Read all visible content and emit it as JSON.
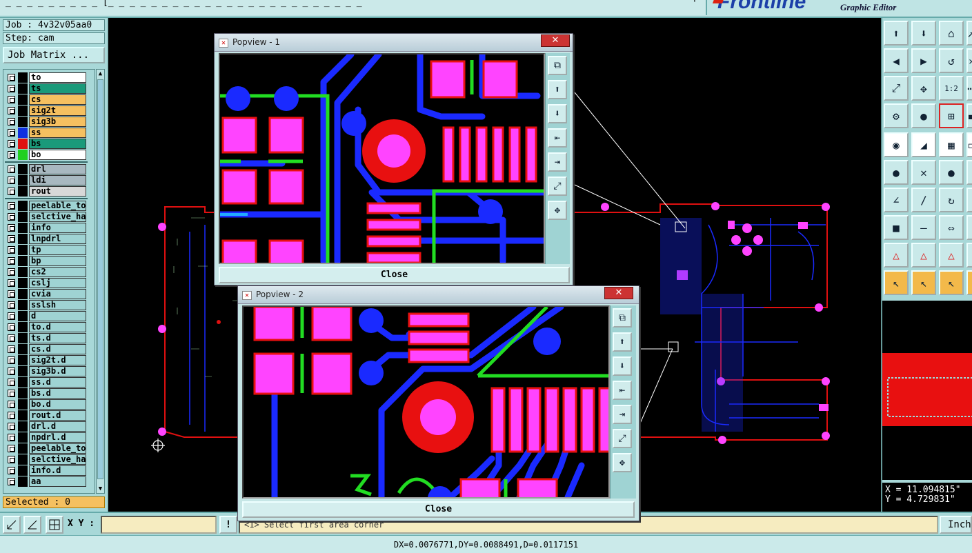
{
  "topbar": {
    "menu_text": "_ _ _ _ _ _ _ _ _ [_ _ _ _ _ _ _ _ _ _ _ _ _ _ _ _ _ _ _ _ _ _ _ _",
    "right_char": "'"
  },
  "brand": {
    "logo": "Frontline",
    "subtitle": "Graphic Editor"
  },
  "job": {
    "job_label": "Job : 4v32v05aa0",
    "step_label": "Step: cam",
    "matrix_button": "Job Matrix ..."
  },
  "layers": [
    {
      "name": "to",
      "swatch": "#000000",
      "bg": "#ffffff"
    },
    {
      "name": "ts",
      "swatch": "#000000",
      "bg": "#1a9a7a"
    },
    {
      "name": "cs",
      "swatch": "#000000",
      "bg": "#f5c060"
    },
    {
      "name": "sig2t",
      "swatch": "#000000",
      "bg": "#f5c060"
    },
    {
      "name": "sig3b",
      "swatch": "#000000",
      "bg": "#f5c060"
    },
    {
      "name": "ss",
      "swatch": "#1030e0",
      "bg": "#f5c060"
    },
    {
      "name": "bs",
      "swatch": "#e01010",
      "bg": "#1a9a7a"
    },
    {
      "name": "bo",
      "swatch": "#20d020",
      "bg": "#ffffff"
    },
    {
      "name": "drl",
      "swatch": "#000000",
      "bg": "#a8b8c0"
    },
    {
      "name": "ldi",
      "swatch": "#000000",
      "bg": "#a8b8c0"
    },
    {
      "name": "rout",
      "swatch": "#000000",
      "bg": "#d8d8d8"
    },
    {
      "name": "peelable_top",
      "swatch": "#000000",
      "bg": "#9fd3d3"
    },
    {
      "name": "selctive_hard",
      "swatch": "#000000",
      "bg": "#9fd3d3"
    },
    {
      "name": "info",
      "swatch": "#000000",
      "bg": "#9fd3d3"
    },
    {
      "name": "lnpdrl",
      "swatch": "#000000",
      "bg": "#9fd3d3"
    },
    {
      "name": "tp",
      "swatch": "#000000",
      "bg": "#9fd3d3"
    },
    {
      "name": "bp",
      "swatch": "#000000",
      "bg": "#9fd3d3"
    },
    {
      "name": "cs2",
      "swatch": "#000000",
      "bg": "#9fd3d3"
    },
    {
      "name": "cslj",
      "swatch": "#000000",
      "bg": "#9fd3d3"
    },
    {
      "name": "cvia",
      "swatch": "#000000",
      "bg": "#9fd3d3"
    },
    {
      "name": "sslsh",
      "swatch": "#000000",
      "bg": "#9fd3d3"
    },
    {
      "name": "d",
      "swatch": "#000000",
      "bg": "#9fd3d3"
    },
    {
      "name": "to.d",
      "swatch": "#000000",
      "bg": "#9fd3d3"
    },
    {
      "name": "ts.d",
      "swatch": "#000000",
      "bg": "#9fd3d3"
    },
    {
      "name": "cs.d",
      "swatch": "#000000",
      "bg": "#9fd3d3"
    },
    {
      "name": "sig2t.d",
      "swatch": "#000000",
      "bg": "#9fd3d3"
    },
    {
      "name": "sig3b.d",
      "swatch": "#000000",
      "bg": "#9fd3d3"
    },
    {
      "name": "ss.d",
      "swatch": "#000000",
      "bg": "#9fd3d3"
    },
    {
      "name": "bs.d",
      "swatch": "#000000",
      "bg": "#9fd3d3"
    },
    {
      "name": "bo.d",
      "swatch": "#000000",
      "bg": "#9fd3d3"
    },
    {
      "name": "rout.d",
      "swatch": "#000000",
      "bg": "#9fd3d3"
    },
    {
      "name": "drl.d",
      "swatch": "#000000",
      "bg": "#9fd3d3"
    },
    {
      "name": "npdrl.d",
      "swatch": "#000000",
      "bg": "#9fd3d3"
    },
    {
      "name": "peelable_top",
      "swatch": "#000000",
      "bg": "#9fd3d3"
    },
    {
      "name": "selctive_hard",
      "swatch": "#000000",
      "bg": "#9fd3d3"
    },
    {
      "name": "info.d",
      "swatch": "#000000",
      "bg": "#9fd3d3"
    },
    {
      "name": "aa",
      "swatch": "#000000",
      "bg": "#9fd3d3"
    }
  ],
  "selected_label": "Selected : 0",
  "popups": [
    {
      "title": "Popview - 1",
      "close_label": "Close"
    },
    {
      "title": "Popview - 2",
      "close_label": "Close"
    }
  ],
  "coords": {
    "x": "X = 11.094815\"",
    "y": "Y = 4.729831\""
  },
  "bottom": {
    "xy_label": "X Y :",
    "xy_value": "",
    "message": "<1>  Select first area corner",
    "units": "Inch"
  },
  "status": "DX=0.0076771,DY=0.0088491,D=0.0117151",
  "colors": {
    "pad": "#ff44ff",
    "pad_border": "#ff1a1a",
    "trace": "#1a2aff",
    "green": "#22dd22",
    "board_outline": "#e01010"
  }
}
